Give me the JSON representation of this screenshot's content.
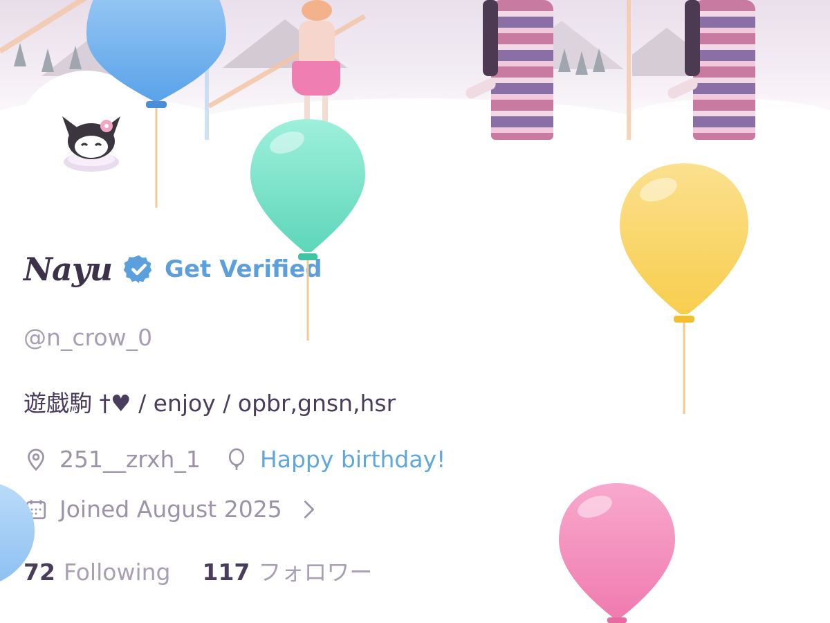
{
  "profile": {
    "display_name": "Nayu",
    "get_verified": "Get Verified",
    "handle": "@n_crow_0",
    "bio": "遊戯駒 †♥ / enjoy / opbr,gnsn,hsr",
    "location": "251__zrxh_1",
    "birthday": "Happy birthday!",
    "joined": "Joined August 2025",
    "following_count": "72",
    "following_label": "Following",
    "followers_count": "117",
    "followers_label": "フォロワー"
  },
  "icons": {
    "verified": "verified-badge-icon",
    "location": "location-pin-icon",
    "birthday": "balloon-icon",
    "joined": "calendar-icon",
    "chevron": "chevron-right-icon"
  },
  "colors": {
    "accent": "#5b9fdc",
    "link": "#5fa7dd",
    "balloon_blue": "#6fb0ee",
    "balloon_green": "#7fe2c9",
    "balloon_yellow": "#fbd56b",
    "balloon_pink": "#f58fbd"
  }
}
